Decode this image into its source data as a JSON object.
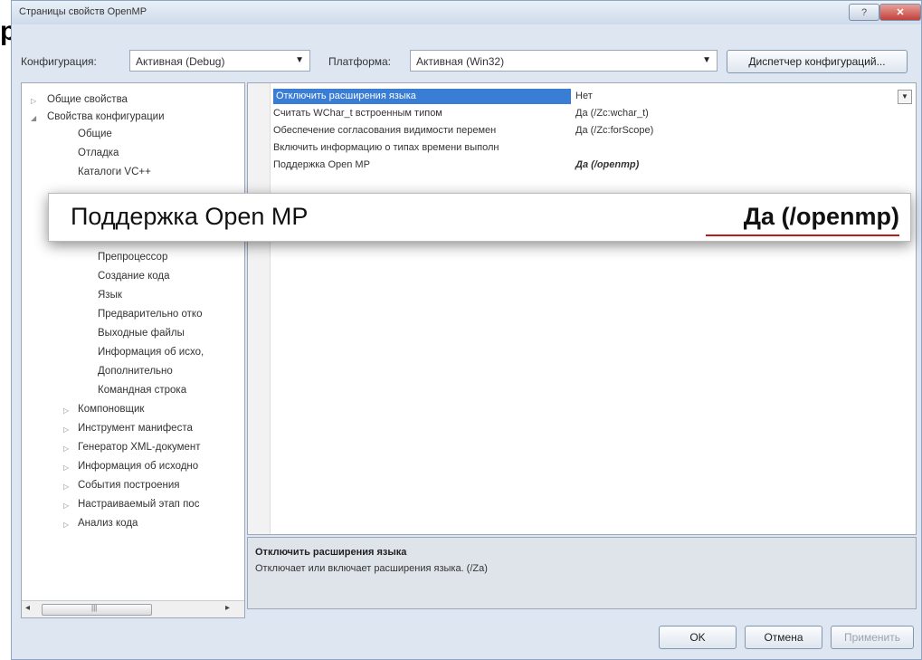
{
  "window": {
    "title": "Страницы свойств OpenMP",
    "help_glyph": "?",
    "close_glyph": "✕",
    "fragment": "p"
  },
  "toolbar": {
    "config_label": "Конфигурация:",
    "config_value": "Активная (Debug)",
    "platform_label": "Платформа:",
    "platform_value": "Активная (Win32)",
    "config_manager": "Диспетчер конфигураций...",
    "dropdown_glyph": "▼"
  },
  "tree": {
    "items": [
      {
        "label": "Общие свойства",
        "arrow": "▷"
      },
      {
        "label": "Свойства конфигурации",
        "arrow": "◢"
      },
      {
        "label": "Общие",
        "arrow": ""
      },
      {
        "label": "Отладка",
        "arrow": ""
      },
      {
        "label": "Каталоги VC++",
        "arrow": ""
      },
      {
        "label": "Препроцессор",
        "arrow": ""
      },
      {
        "label": "Создание кода",
        "arrow": ""
      },
      {
        "label": "Язык",
        "arrow": ""
      },
      {
        "label": "Предварительно отко",
        "arrow": ""
      },
      {
        "label": "Выходные файлы",
        "arrow": ""
      },
      {
        "label": "Информация об исхо,",
        "arrow": ""
      },
      {
        "label": "Дополнительно",
        "arrow": ""
      },
      {
        "label": "Командная строка",
        "arrow": ""
      },
      {
        "label": "Компоновщик",
        "arrow": "▷"
      },
      {
        "label": "Инструмент манифеста",
        "arrow": "▷"
      },
      {
        "label": "Генератор XML-документ",
        "arrow": "▷"
      },
      {
        "label": "Информация об исходно",
        "arrow": "▷"
      },
      {
        "label": "События построения",
        "arrow": "▷"
      },
      {
        "label": "Настраиваемый этап пос",
        "arrow": "▷"
      },
      {
        "label": "Анализ кода",
        "arrow": "▷"
      }
    ],
    "scroll_left": "◂",
    "scroll_thumb": "|||",
    "scroll_right": "▸"
  },
  "properties": {
    "rows": [
      {
        "name": "Отключить расширения языка",
        "value": "Нет"
      },
      {
        "name": "Считать WChar_t встроенным типом",
        "value": "Да (/Zc:wchar_t)"
      },
      {
        "name": "Обеспечение согласования видимости перемен",
        "value": "Да (/Zc:forScope)"
      },
      {
        "name": "Включить информацию о типах времени выполн",
        "value": ""
      },
      {
        "name": "Поддержка Open MP",
        "value": "Да (/openmp)"
      }
    ]
  },
  "description": {
    "title": "Отключить расширения языка",
    "text": "Отключает или включает расширения языка.    (/Za)"
  },
  "zoom": {
    "name": "Поддержка Open MP",
    "value": "Да (/openmp)"
  },
  "buttons": {
    "ok": "OK",
    "cancel": "Отмена",
    "apply": "Применить"
  }
}
